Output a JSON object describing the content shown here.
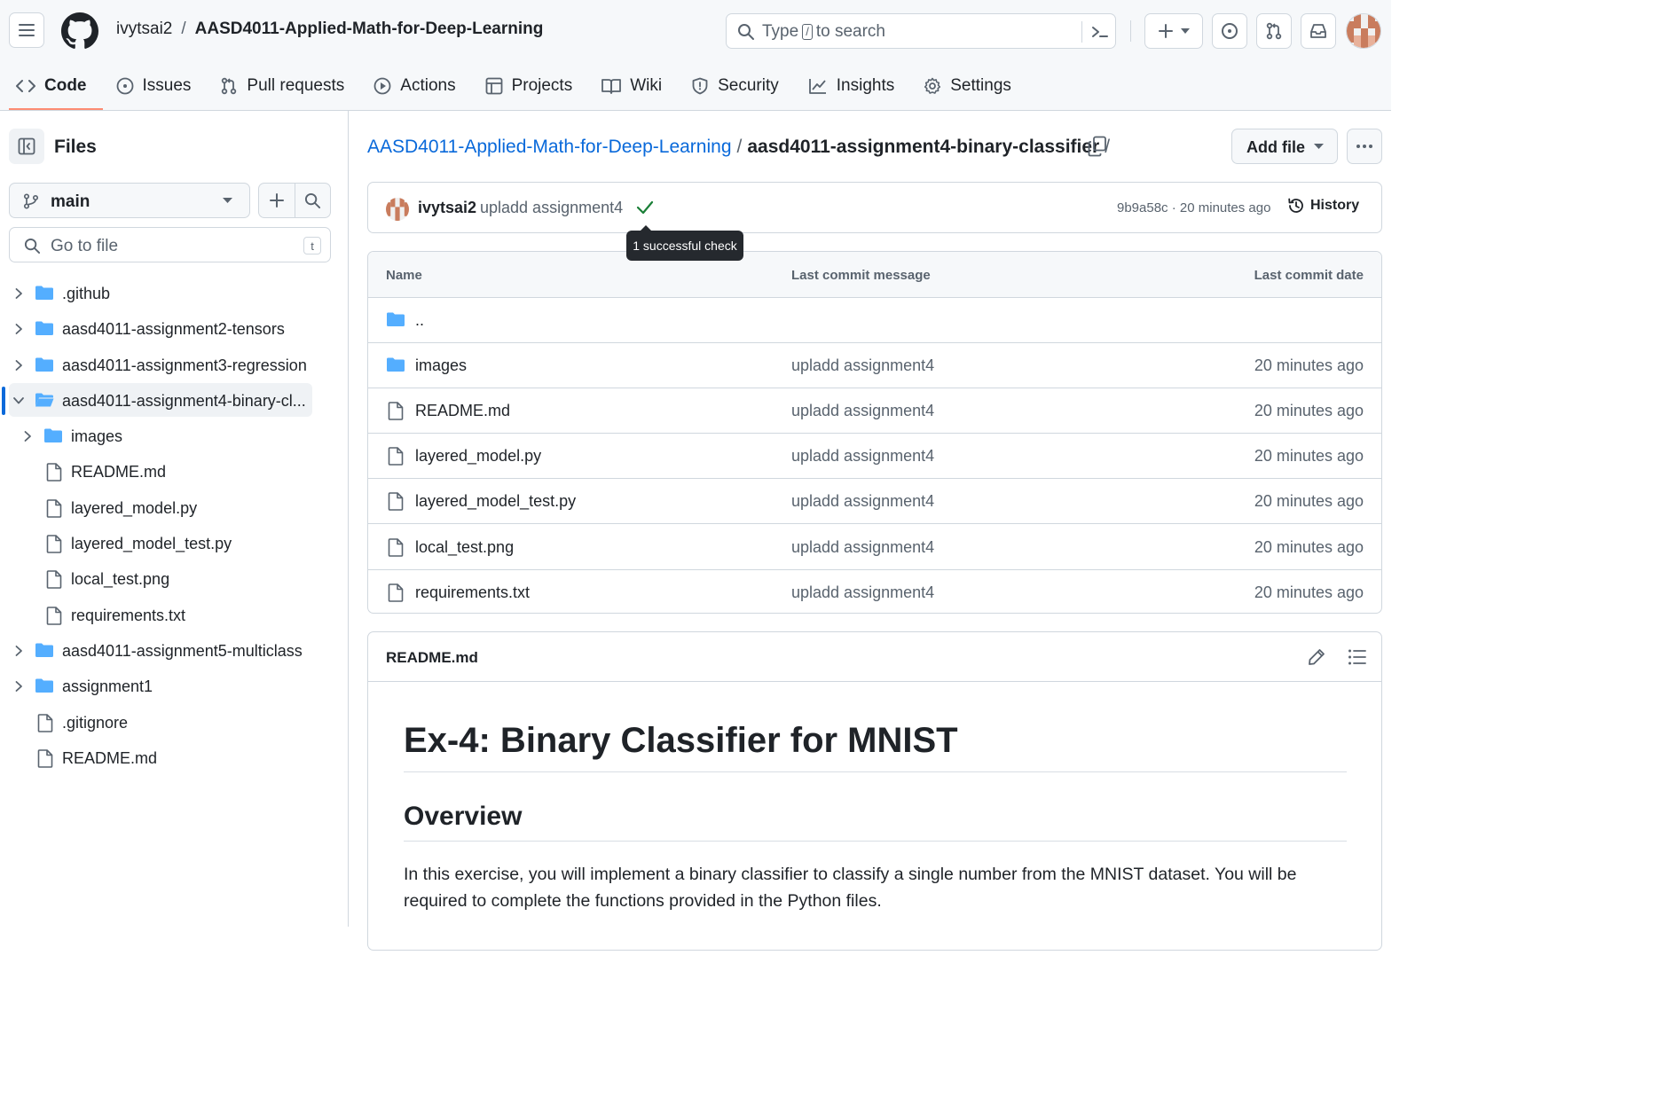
{
  "header": {
    "owner": "ivytsai2",
    "separator": "/",
    "repo": "AASD4011-Applied-Math-for-Deep-Learning",
    "search": {
      "prefix": "Type",
      "key": "/",
      "suffix": "to search"
    }
  },
  "tabs": [
    {
      "label": "Code",
      "icon": "code-icon",
      "active": true
    },
    {
      "label": "Issues",
      "icon": "issue-icon"
    },
    {
      "label": "Pull requests",
      "icon": "pull-request-icon"
    },
    {
      "label": "Actions",
      "icon": "play-icon"
    },
    {
      "label": "Projects",
      "icon": "table-icon"
    },
    {
      "label": "Wiki",
      "icon": "book-icon"
    },
    {
      "label": "Security",
      "icon": "shield-icon"
    },
    {
      "label": "Insights",
      "icon": "graph-icon"
    },
    {
      "label": "Settings",
      "icon": "gear-icon"
    }
  ],
  "sidebar": {
    "title": "Files",
    "branch": "main",
    "goto_placeholder": "Go to file",
    "goto_key": "t",
    "tree": [
      {
        "name": ".github",
        "type": "folder",
        "depth": 0,
        "expandable": true
      },
      {
        "name": "aasd4011-assignment2-tensors",
        "type": "folder",
        "depth": 0,
        "expandable": true
      },
      {
        "name": "aasd4011-assignment3-regression",
        "type": "folder",
        "depth": 0,
        "expandable": true
      },
      {
        "name": "aasd4011-assignment4-binary-cl...",
        "type": "folder-open",
        "depth": 0,
        "expandable": true,
        "expanded": true,
        "selected": true
      },
      {
        "name": "images",
        "type": "folder",
        "depth": 1,
        "expandable": true
      },
      {
        "name": "README.md",
        "type": "file",
        "depth": 1
      },
      {
        "name": "layered_model.py",
        "type": "file",
        "depth": 1
      },
      {
        "name": "layered_model_test.py",
        "type": "file",
        "depth": 1
      },
      {
        "name": "local_test.png",
        "type": "file",
        "depth": 1
      },
      {
        "name": "requirements.txt",
        "type": "file",
        "depth": 1
      },
      {
        "name": "aasd4011-assignment5-multiclass",
        "type": "folder",
        "depth": 0,
        "expandable": true
      },
      {
        "name": "assignment1",
        "type": "folder",
        "depth": 0,
        "expandable": true
      },
      {
        "name": ".gitignore",
        "type": "file",
        "depth": 0
      },
      {
        "name": "README.md",
        "type": "file",
        "depth": 0
      }
    ]
  },
  "main": {
    "path": {
      "repo_link": "AASD4011-Applied-Math-for-Deep-Learning",
      "separator": "/",
      "current": "aasd4011-assignment4-binary-classifier",
      "trailing": "/"
    },
    "add_file_label": "Add file",
    "commit": {
      "author": "ivytsai2",
      "message": "upladd assignment4",
      "meta": "9b9a58c · 20 minutes ago",
      "history_label": "History",
      "tooltip": "1 successful check"
    },
    "table": {
      "headers": {
        "name": "Name",
        "message": "Last commit message",
        "date": "Last commit date"
      },
      "parent": "..",
      "rows": [
        {
          "name": "images",
          "type": "folder",
          "message": "upladd assignment4",
          "date": "20 minutes ago"
        },
        {
          "name": "README.md",
          "type": "file",
          "message": "upladd assignment4",
          "date": "20 minutes ago"
        },
        {
          "name": "layered_model.py",
          "type": "file",
          "message": "upladd assignment4",
          "date": "20 minutes ago"
        },
        {
          "name": "layered_model_test.py",
          "type": "file",
          "message": "upladd assignment4",
          "date": "20 minutes ago"
        },
        {
          "name": "local_test.png",
          "type": "file",
          "message": "upladd assignment4",
          "date": "20 minutes ago"
        },
        {
          "name": "requirements.txt",
          "type": "file",
          "message": "upladd assignment4",
          "date": "20 minutes ago"
        }
      ]
    },
    "readme": {
      "title": "README.md",
      "h1": "Ex-4: Binary Classifier for MNIST",
      "h2": "Overview",
      "paragraph": "In this exercise, you will implement a binary classifier to classify a single number from the MNIST dataset. You will be required to complete the functions provided in the Python files."
    }
  },
  "colors": {
    "accent_link": "#0969da",
    "folder": "#54aeff",
    "active_tab_underline": "#fd8c73",
    "success": "#1a7f37"
  }
}
